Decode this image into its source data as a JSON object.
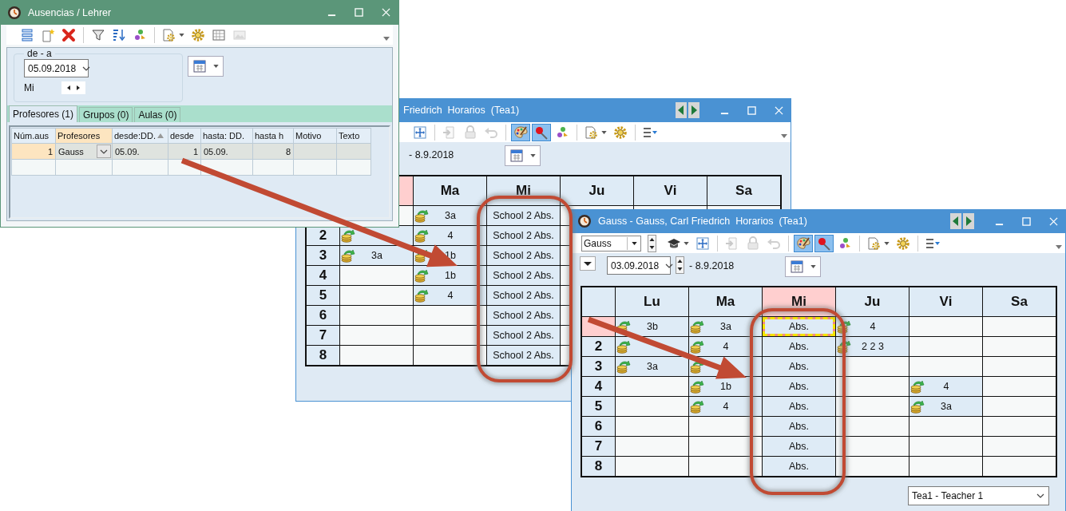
{
  "absences_window": {
    "title": "Ausencias / Lehrer",
    "toolbar": [
      {
        "selected": false,
        "disabled": false
      },
      {
        "selected": false,
        "disabled": false
      },
      {
        "selected": false,
        "disabled": false
      },
      {
        "selected": false,
        "disabled": false
      },
      {
        "selected": false,
        "disabled": false
      },
      {
        "selected": false,
        "disabled": false
      },
      {
        "selected": false,
        "disabled": false
      },
      {
        "selected": false,
        "disabled": false
      },
      {
        "selected": false,
        "disabled": false
      },
      {
        "selected": false,
        "disabled": true
      }
    ],
    "range_label": "de - a",
    "date": "05.09.2018",
    "weekday": "Mi",
    "tabs": [
      {
        "label": "Profesores (1)",
        "selected": true
      },
      {
        "label": "Grupos (0)",
        "selected": false
      },
      {
        "label": "Aulas (0)",
        "selected": false
      }
    ],
    "table": {
      "columns": [
        {
          "label": "Núm.aus",
          "selected": false,
          "sorted": false
        },
        {
          "label": "Profesores",
          "selected": true,
          "sorted": false
        },
        {
          "label": "desde:DD.",
          "selected": false,
          "sorted": true
        },
        {
          "label": "desde",
          "selected": false,
          "sorted": false
        },
        {
          "label": "hasta: DD.",
          "selected": false,
          "sorted": false
        },
        {
          "label": "hasta h",
          "selected": false,
          "sorted": false
        },
        {
          "label": "Motivo",
          "selected": false,
          "sorted": false
        },
        {
          "label": "Texto",
          "selected": false,
          "sorted": false
        }
      ],
      "rows": [
        {
          "selected": true,
          "cells": [
            "1",
            "Gauss",
            "05.09.",
            "1",
            "05.09.",
            "8"
          ]
        }
      ]
    }
  },
  "timetable_back_window": {
    "title": "Friedrich  Horarios  (Tea1)",
    "toolbar": [
      {
        "selected": false,
        "disabled": false
      },
      {
        "selected": false,
        "disabled": true
      },
      {
        "selected": false,
        "disabled": true
      },
      {
        "selected": false,
        "disabled": true
      },
      {
        "selected": true,
        "disabled": false
      },
      {
        "selected": true,
        "disabled": false
      },
      {
        "selected": false,
        "disabled": false
      },
      {
        "selected": false,
        "disabled": false
      },
      {
        "selected": false,
        "disabled": false
      },
      {
        "selected": false,
        "disabled": false
      }
    ],
    "date_to": "- 8.9.2018",
    "days": [
      {
        "today": true
      },
      {
        "label": "Ma",
        "today": false
      },
      {
        "label": "Mi",
        "today": false
      },
      {
        "label": "Ju",
        "today": false
      },
      {
        "label": "Vi",
        "today": false
      },
      {
        "label": "Sa",
        "today": false
      }
    ],
    "rows": [
      {
        "cells": [
          {
            "kind": "empty"
          },
          {
            "kind": "lesson",
            "text": "3a"
          },
          {
            "kind": "absence",
            "text": "School 2 Abs."
          },
          {
            "kind": "empty"
          },
          {
            "kind": "empty"
          },
          {
            "kind": "empty"
          }
        ]
      },
      {
        "period": "2",
        "cells": [
          {
            "kind": "lesson"
          },
          {
            "kind": "lesson",
            "text": "4"
          },
          {
            "kind": "absence",
            "text": "School 2 Abs."
          },
          {
            "kind": "empty"
          },
          {
            "kind": "empty"
          },
          {
            "kind": "empty"
          }
        ]
      },
      {
        "period": "3",
        "cells": [
          {
            "kind": "lesson",
            "text": "3a"
          },
          {
            "kind": "lesson",
            "text": "1b"
          },
          {
            "kind": "absence",
            "text": "School 2 Abs."
          },
          {
            "kind": "empty"
          },
          {
            "kind": "empty"
          },
          {
            "kind": "empty"
          }
        ]
      },
      {
        "period": "4",
        "cells": [
          {
            "kind": "empty"
          },
          {
            "kind": "lesson",
            "text": "1b"
          },
          {
            "kind": "absence",
            "text": "School 2 Abs."
          },
          {
            "kind": "empty"
          },
          {
            "kind": "empty"
          },
          {
            "kind": "empty"
          }
        ]
      },
      {
        "period": "5",
        "cells": [
          {
            "kind": "empty"
          },
          {
            "kind": "lesson",
            "text": "4"
          },
          {
            "kind": "absence",
            "text": "School 2 Abs."
          },
          {
            "kind": "empty"
          },
          {
            "kind": "empty"
          },
          {
            "kind": "empty"
          }
        ]
      },
      {
        "period": "6",
        "cells": [
          {
            "kind": "empty"
          },
          {
            "kind": "empty"
          },
          {
            "kind": "absence",
            "text": "School 2 Abs."
          },
          {
            "kind": "empty"
          },
          {
            "kind": "empty"
          },
          {
            "kind": "empty"
          }
        ]
      },
      {
        "period": "7",
        "cells": [
          {
            "kind": "empty"
          },
          {
            "kind": "empty"
          },
          {
            "kind": "absence",
            "text": "School 2 Abs."
          },
          {
            "kind": "empty"
          },
          {
            "kind": "empty"
          },
          {
            "kind": "empty"
          }
        ]
      },
      {
        "period": "8",
        "cells": [
          {
            "kind": "empty"
          },
          {
            "kind": "empty"
          },
          {
            "kind": "absence",
            "text": "School 2 Abs."
          },
          {
            "kind": "empty"
          },
          {
            "kind": "empty"
          },
          {
            "kind": "empty"
          }
        ]
      }
    ]
  },
  "timetable_front_window": {
    "title": "Gauss - Gauss, Carl Friedrich  Horarios  (Tea1)",
    "teacher": "Gauss",
    "toolbar": [
      {
        "selected": false,
        "disabled": false
      },
      {
        "selected": false,
        "disabled": false
      },
      {
        "selected": false,
        "disabled": true
      },
      {
        "selected": false,
        "disabled": true
      },
      {
        "selected": false,
        "disabled": true
      },
      {
        "selected": true,
        "disabled": false
      },
      {
        "selected": true,
        "disabled": false
      },
      {
        "selected": false,
        "disabled": false
      },
      {
        "selected": false,
        "disabled": false
      },
      {
        "selected": false,
        "disabled": false
      },
      {
        "selected": false,
        "disabled": false
      }
    ],
    "date": "03.09.2018",
    "date_to": "- 8.9.2018",
    "days": [
      {
        "label": "Lu",
        "today": false
      },
      {
        "label": "Ma",
        "today": false
      },
      {
        "label": "Mi",
        "today": true
      },
      {
        "label": "Ju",
        "today": false
      },
      {
        "label": "Vi",
        "today": false
      },
      {
        "label": "Sa",
        "today": false
      }
    ],
    "rows": [
      {
        "current": true,
        "cells": [
          {
            "kind": "lesson",
            "text": "3b",
            "selected": false
          },
          {
            "kind": "lesson",
            "text": "3a",
            "selected": false
          },
          {
            "kind": "absence",
            "text": "Abs.",
            "selected": true
          },
          {
            "kind": "lesson",
            "text": "4",
            "selected": false
          },
          {
            "kind": "empty",
            "selected": false
          },
          {
            "kind": "empty",
            "selected": false
          }
        ]
      },
      {
        "period": "2",
        "current": false,
        "cells": [
          {
            "kind": "lesson",
            "selected": false
          },
          {
            "kind": "lesson",
            "text": "4",
            "selected": false
          },
          {
            "kind": "absence",
            "text": "Abs.",
            "selected": false
          },
          {
            "kind": "lesson",
            "text": "2 2 3",
            "selected": false
          },
          {
            "kind": "empty",
            "selected": false
          },
          {
            "kind": "empty",
            "selected": false
          }
        ]
      },
      {
        "period": "3",
        "current": false,
        "cells": [
          {
            "kind": "lesson",
            "text": "3a",
            "selected": false
          },
          {
            "kind": "lesson",
            "selected": false
          },
          {
            "kind": "absence",
            "text": "Abs.",
            "selected": false
          },
          {
            "kind": "empty",
            "selected": false
          },
          {
            "kind": "empty",
            "selected": false
          },
          {
            "kind": "empty",
            "selected": false
          }
        ]
      },
      {
        "period": "4",
        "current": false,
        "cells": [
          {
            "kind": "empty",
            "selected": false
          },
          {
            "kind": "lesson",
            "text": "1b",
            "selected": false
          },
          {
            "kind": "absence",
            "text": "Abs.",
            "selected": false
          },
          {
            "kind": "empty",
            "selected": false
          },
          {
            "kind": "lesson",
            "text": "4",
            "selected": false
          },
          {
            "kind": "empty",
            "selected": false
          }
        ]
      },
      {
        "period": "5",
        "current": false,
        "cells": [
          {
            "kind": "empty",
            "selected": false
          },
          {
            "kind": "lesson",
            "text": "4",
            "selected": false
          },
          {
            "kind": "absence",
            "text": "Abs.",
            "selected": false
          },
          {
            "kind": "empty",
            "selected": false
          },
          {
            "kind": "lesson",
            "text": "3a",
            "selected": false
          },
          {
            "kind": "empty",
            "selected": false
          }
        ]
      },
      {
        "period": "6",
        "current": false,
        "cells": [
          {
            "kind": "empty",
            "selected": false
          },
          {
            "kind": "empty",
            "selected": false
          },
          {
            "kind": "absence",
            "text": "Abs.",
            "selected": false
          },
          {
            "kind": "empty",
            "selected": false
          },
          {
            "kind": "empty",
            "selected": false
          },
          {
            "kind": "empty",
            "selected": false
          }
        ]
      },
      {
        "period": "7",
        "current": false,
        "cells": [
          {
            "kind": "empty",
            "selected": false
          },
          {
            "kind": "empty",
            "selected": false
          },
          {
            "kind": "absence",
            "text": "Abs.",
            "selected": false
          },
          {
            "kind": "empty",
            "selected": false
          },
          {
            "kind": "empty",
            "selected": false
          },
          {
            "kind": "empty",
            "selected": false
          }
        ]
      },
      {
        "period": "8",
        "current": false,
        "cells": [
          {
            "kind": "empty",
            "selected": false
          },
          {
            "kind": "empty",
            "selected": false
          },
          {
            "kind": "absence",
            "text": "Abs.",
            "selected": false
          },
          {
            "kind": "empty",
            "selected": false
          },
          {
            "kind": "empty",
            "selected": false
          },
          {
            "kind": "empty",
            "selected": false
          }
        ]
      }
    ],
    "status_selection": "Tea1 - Teacher 1"
  }
}
